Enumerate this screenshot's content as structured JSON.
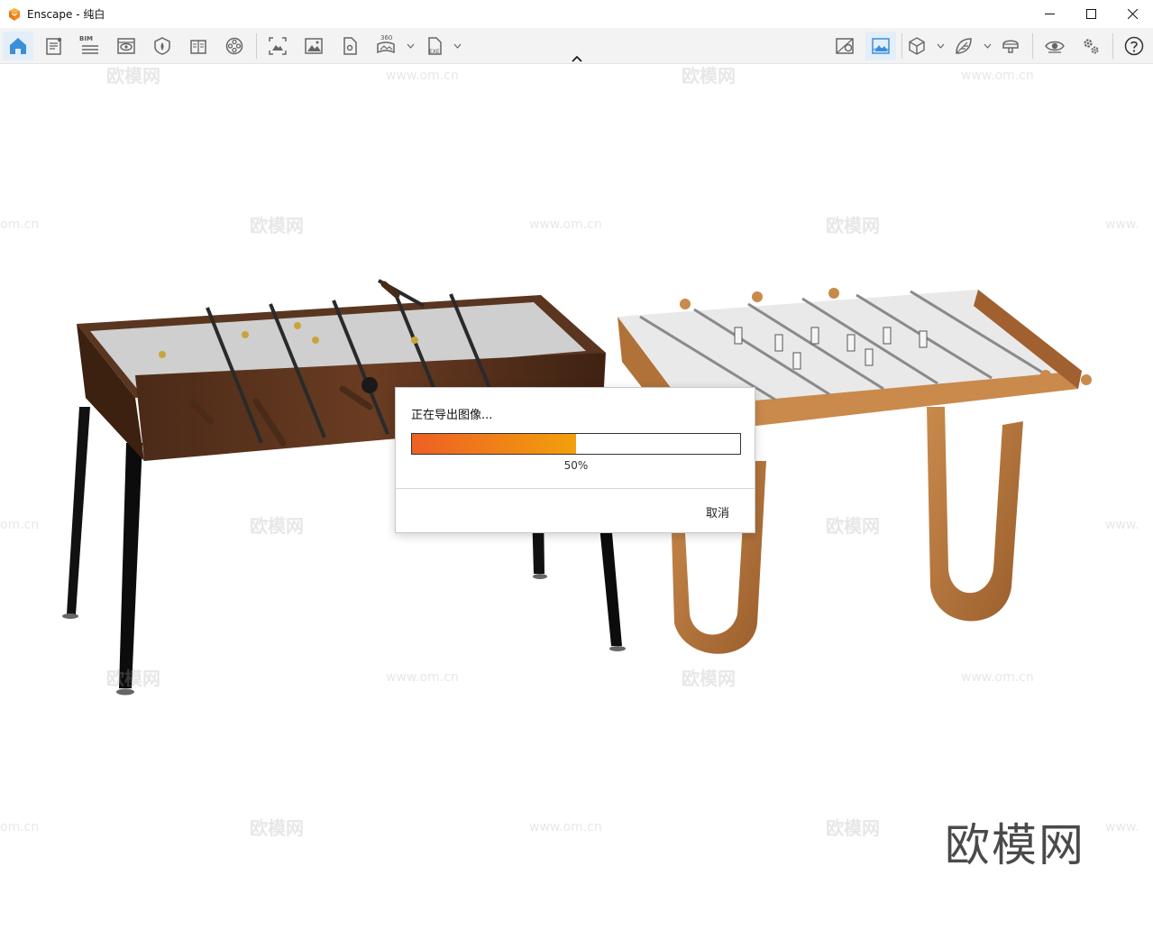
{
  "window": {
    "title": "Enscape - 纯白"
  },
  "toolbar": {
    "bim_label": "BIM",
    "pano_label": "360",
    "exe_label": "EXE"
  },
  "dialog": {
    "title": "正在导出图像...",
    "progress_percent": 50,
    "progress_text": "50%",
    "cancel_label": "取消"
  },
  "watermarks": {
    "brand": "欧模网",
    "site": "www.om.cn",
    "site_partial": "om.cn",
    "site_partial2": "www."
  },
  "colors": {
    "progress_start": "#ee5f24",
    "progress_end": "#f2a00c",
    "toolbar_accent": "#3b8fd9",
    "app_logo": "#f08a1c"
  }
}
